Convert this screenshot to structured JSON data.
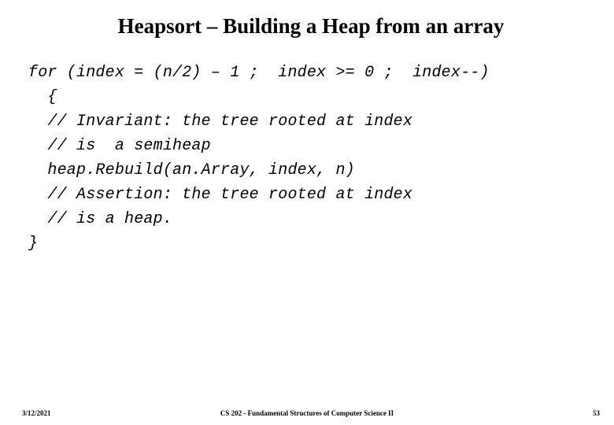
{
  "title": "Heapsort – Building a Heap from an array",
  "code": {
    "l1": "for (index = (n/2) – 1 ;  index >= 0 ;  index--)",
    "l2": "  {",
    "l3": "  // Invariant: the tree rooted at index",
    "l4": "  // is  a semiheap",
    "l5": "  heap.Rebuild(an.Array, index, n)",
    "l6": "  // Assertion: the tree rooted at index",
    "l7": "  // is a heap.",
    "l8": "}"
  },
  "footer": {
    "date": "3/12/2021",
    "course": "CS 202 - Fundamental Structures of Computer Science II",
    "page": "53"
  }
}
